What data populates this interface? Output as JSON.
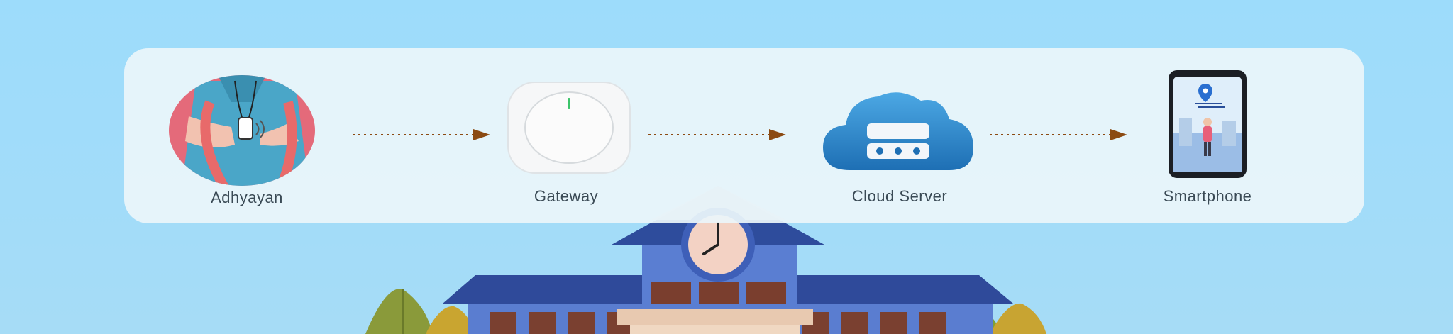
{
  "diagram": {
    "nodes": [
      {
        "label": "Adhyayan",
        "icon": "student-wearable-icon"
      },
      {
        "label": "Gateway",
        "icon": "gateway-device-icon"
      },
      {
        "label": "Cloud Server",
        "icon": "cloud-server-icon"
      },
      {
        "label": "Smartphone",
        "icon": "smartphone-location-icon"
      }
    ],
    "edges": [
      {
        "from": "Adhyayan",
        "to": "Gateway"
      },
      {
        "from": "Gateway",
        "to": "Cloud Server"
      },
      {
        "from": "Cloud Server",
        "to": "Smartphone"
      }
    ]
  },
  "colors": {
    "background": "#9ddcfb",
    "arrow": "#8b4a12",
    "school_wall": "#5b7fd0",
    "school_roof": "#2f4a9a"
  }
}
